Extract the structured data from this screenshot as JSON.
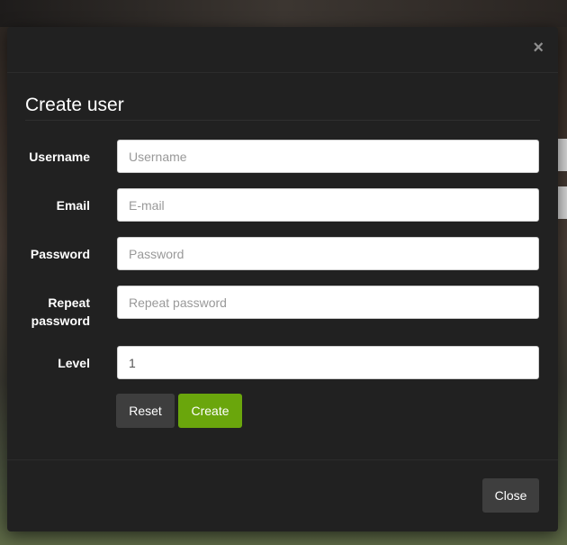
{
  "modal": {
    "close_icon": "×",
    "title": "Create user"
  },
  "form": {
    "fields": [
      {
        "label": "Username",
        "placeholder": "Username",
        "value": ""
      },
      {
        "label": "Email",
        "placeholder": "E-mail",
        "value": ""
      },
      {
        "label": "Password",
        "placeholder": "Password",
        "value": ""
      },
      {
        "label": "Repeat password",
        "placeholder": "Repeat password",
        "value": ""
      },
      {
        "label": "Level",
        "placeholder": "",
        "value": "1"
      }
    ],
    "reset_label": "Reset",
    "create_label": "Create"
  },
  "footer": {
    "close_label": "Close"
  },
  "colors": {
    "modal_bg": "#212121",
    "create_button": "#6aa60c",
    "secondary_button": "#3e3e3e"
  }
}
